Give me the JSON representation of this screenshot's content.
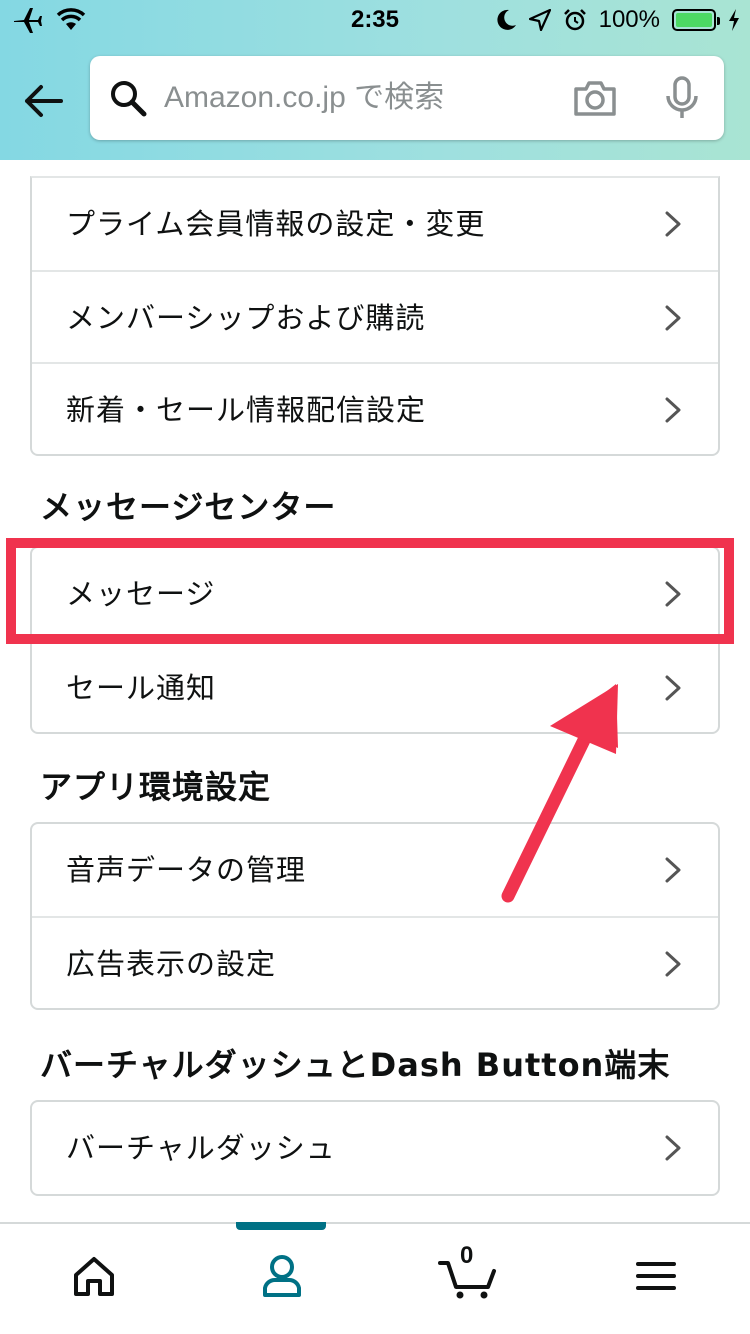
{
  "status_bar": {
    "time": "2:35",
    "battery_text": "100%",
    "battery_level": 1.0
  },
  "search": {
    "placeholder": "Amazon.co.jp で検索"
  },
  "account_card": {
    "items": [
      {
        "label": "プライム会員情報の設定・変更"
      },
      {
        "label": "メンバーシップおよび購読"
      },
      {
        "label": "新着・セール情報配信設定"
      }
    ]
  },
  "message_center": {
    "title": "メッセージセンター",
    "items": [
      {
        "label": "メッセージ"
      },
      {
        "label": "セール通知"
      }
    ]
  },
  "app_settings": {
    "title": "アプリ環境設定",
    "items": [
      {
        "label": "音声データの管理"
      },
      {
        "label": "広告表示の設定"
      }
    ]
  },
  "dash": {
    "title": "バーチャルダッシュとDash Button端末",
    "items": [
      {
        "label": "バーチャルダッシュ"
      }
    ]
  },
  "tab_bar": {
    "cart_count": "0",
    "active_tab": "account"
  },
  "colors": {
    "header_gradient_start": "#84d8e3",
    "header_gradient_end": "#a9e4d3",
    "highlight": "#f0334e",
    "active_tab": "#007185",
    "battery": "#4cd964"
  }
}
